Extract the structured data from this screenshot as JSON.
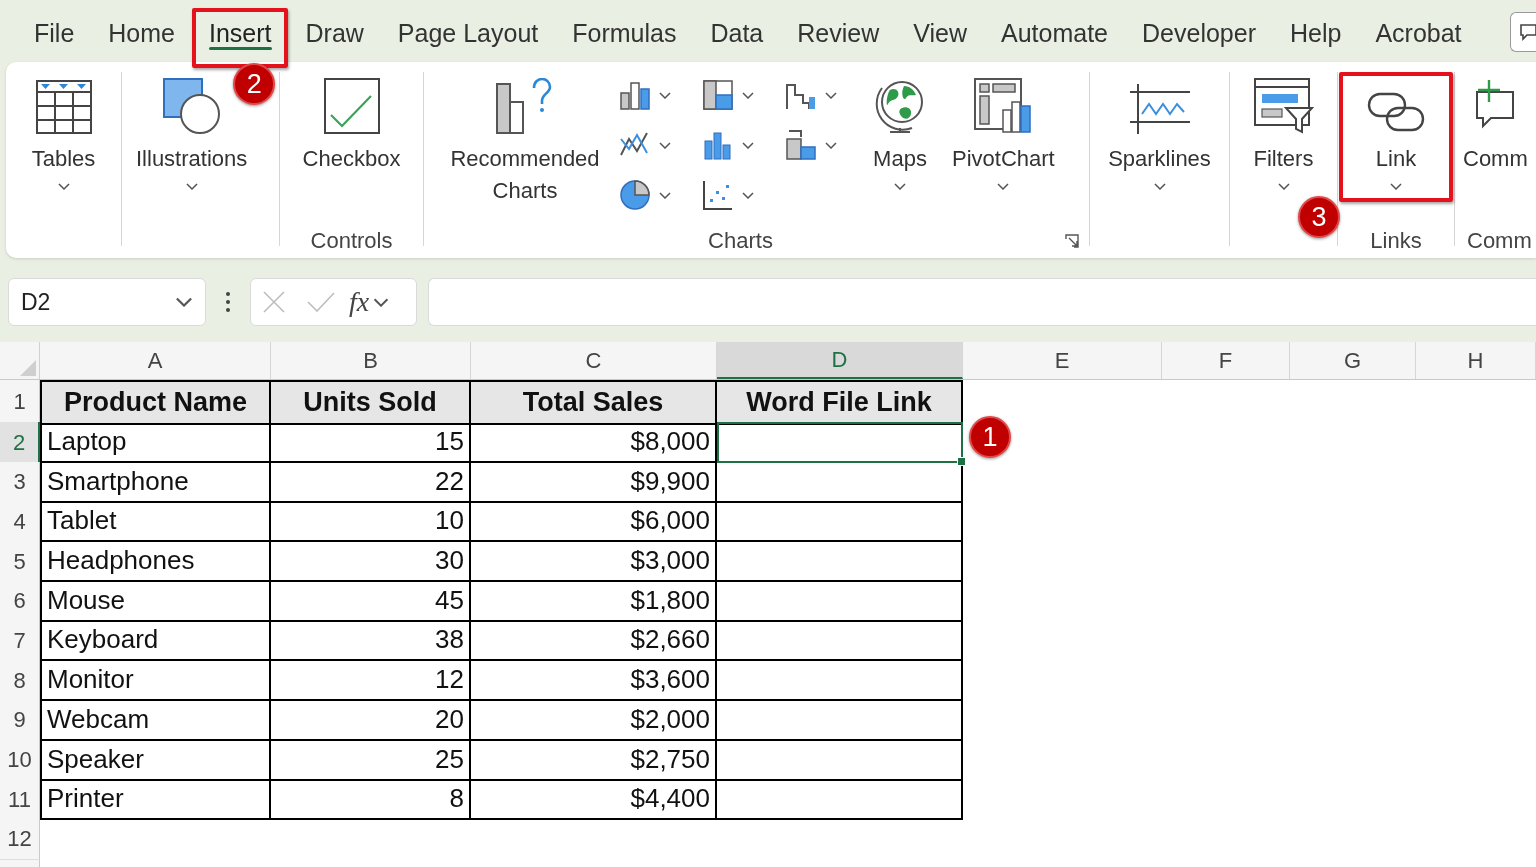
{
  "menu_tabs": [
    {
      "label": "File",
      "selected": false,
      "highlighted": false
    },
    {
      "label": "Home",
      "selected": false,
      "highlighted": false
    },
    {
      "label": "Insert",
      "selected": true,
      "highlighted": true,
      "callout": "2"
    },
    {
      "label": "Draw",
      "selected": false,
      "highlighted": false
    },
    {
      "label": "Page Layout",
      "selected": false,
      "highlighted": false
    },
    {
      "label": "Formulas",
      "selected": false,
      "highlighted": false
    },
    {
      "label": "Data",
      "selected": false,
      "highlighted": false
    },
    {
      "label": "Review",
      "selected": false,
      "highlighted": false
    },
    {
      "label": "View",
      "selected": false,
      "highlighted": false
    },
    {
      "label": "Automate",
      "selected": false,
      "highlighted": false
    },
    {
      "label": "Developer",
      "selected": false,
      "highlighted": false
    },
    {
      "label": "Help",
      "selected": false,
      "highlighted": false
    },
    {
      "label": "Acrobat",
      "selected": false,
      "highlighted": false
    }
  ],
  "ribbon": {
    "groups": [
      {
        "launcher": false,
        "items": [
          {
            "kind": "large",
            "label": "Tables",
            "dropdown": true,
            "highlighted": false
          }
        ]
      },
      {
        "launcher": false,
        "items": [
          {
            "kind": "large",
            "label": "Illustrations",
            "dropdown": true,
            "highlighted": false
          }
        ]
      },
      {
        "label": "Controls",
        "launcher": false,
        "items": [
          {
            "kind": "large",
            "label": "Checkbox",
            "dropdown": false,
            "highlighted": false
          }
        ]
      },
      {
        "label": "Charts",
        "launcher": true,
        "items": [
          {
            "kind": "large",
            "label": "Recommended Charts",
            "dropdown": false,
            "highlighted": false
          },
          {
            "kind": "gallery",
            "highlighted": false
          },
          {
            "kind": "large",
            "label": "Maps",
            "dropdown": true,
            "highlighted": false
          },
          {
            "kind": "large",
            "label": "PivotChart",
            "dropdown": true,
            "highlighted": false
          }
        ]
      },
      {
        "launcher": false,
        "items": [
          {
            "kind": "large",
            "label": "Sparklines",
            "dropdown": true,
            "highlighted": false
          }
        ]
      },
      {
        "launcher": false,
        "items": [
          {
            "kind": "large",
            "label": "Filters",
            "dropdown": true,
            "highlighted": false
          }
        ]
      },
      {
        "label": "Links",
        "launcher": false,
        "items": [
          {
            "kind": "large",
            "label": "Link",
            "dropdown": true,
            "highlighted": true,
            "callout": "3"
          }
        ]
      },
      {
        "label": "Comm",
        "launcher": false,
        "items": [
          {
            "kind": "large",
            "label": "Comm",
            "dropdown": false,
            "highlighted": false
          }
        ]
      }
    ]
  },
  "formula_bar": {
    "name_box": "D2",
    "function_button": "fx"
  },
  "sheet": {
    "columns": [
      {
        "label": "A",
        "selected": false
      },
      {
        "label": "B",
        "selected": false
      },
      {
        "label": "C",
        "selected": false
      },
      {
        "label": "D",
        "selected": true
      },
      {
        "label": "E",
        "selected": false
      },
      {
        "label": "F",
        "selected": false
      },
      {
        "label": "G",
        "selected": false
      },
      {
        "label": "H",
        "selected": false
      }
    ],
    "row_numbers": [
      {
        "label": "1",
        "selected": false
      },
      {
        "label": "2",
        "selected": true
      },
      {
        "label": "3",
        "selected": false
      },
      {
        "label": "4",
        "selected": false
      },
      {
        "label": "5",
        "selected": false
      },
      {
        "label": "6",
        "selected": false
      },
      {
        "label": "7",
        "selected": false
      },
      {
        "label": "8",
        "selected": false
      },
      {
        "label": "9",
        "selected": false
      },
      {
        "label": "10",
        "selected": false
      },
      {
        "label": "11",
        "selected": false
      },
      {
        "label": "12",
        "selected": false
      }
    ],
    "table": {
      "columns": [
        "Product Name",
        "Units Sold",
        "Total Sales",
        "Word File Link"
      ],
      "rows": [
        {
          "cells": [
            "Laptop",
            "15",
            "$8,000"
          ],
          "link_cell": {
            "selected": true,
            "callout": "1"
          }
        },
        {
          "cells": [
            "Smartphone",
            "22",
            "$9,900"
          ],
          "link_cell": {
            "selected": false
          }
        },
        {
          "cells": [
            "Tablet",
            "10",
            "$6,000"
          ],
          "link_cell": {
            "selected": false
          }
        },
        {
          "cells": [
            "Headphones",
            "30",
            "$3,000"
          ],
          "link_cell": {
            "selected": false
          }
        },
        {
          "cells": [
            "Mouse",
            "45",
            "$1,800"
          ],
          "link_cell": {
            "selected": false
          }
        },
        {
          "cells": [
            "Keyboard",
            "38",
            "$2,660"
          ],
          "link_cell": {
            "selected": false
          }
        },
        {
          "cells": [
            "Monitor",
            "12",
            "$3,600"
          ],
          "link_cell": {
            "selected": false
          }
        },
        {
          "cells": [
            "Webcam",
            "20",
            "$2,000"
          ],
          "link_cell": {
            "selected": false
          }
        },
        {
          "cells": [
            "Speaker",
            "25",
            "$2,750"
          ],
          "link_cell": {
            "selected": false
          }
        },
        {
          "cells": [
            "Printer",
            "8",
            "$4,400"
          ],
          "link_cell": {
            "selected": false
          }
        }
      ]
    }
  }
}
